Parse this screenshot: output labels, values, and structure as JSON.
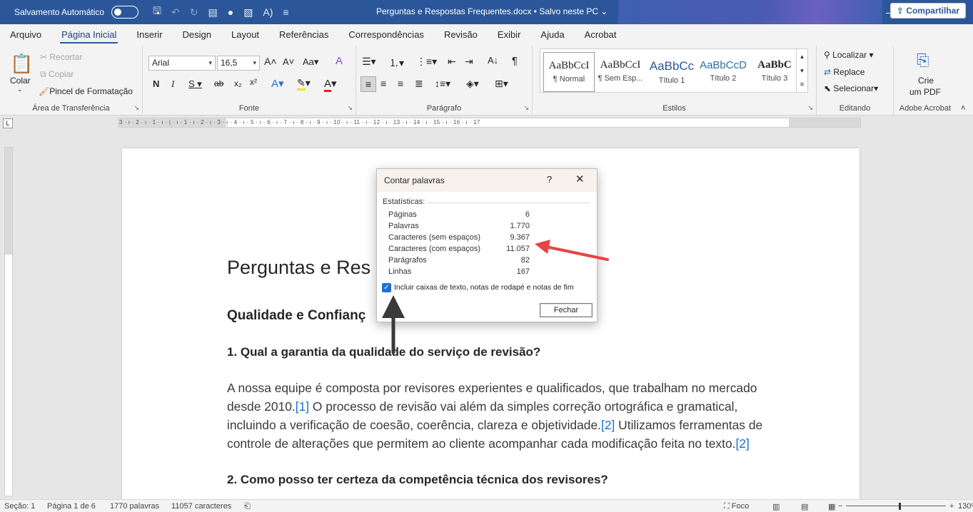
{
  "titlebar": {
    "autosave_label": "Salvamento Automático",
    "doc_title": "Perguntas e Respostas Frequentes.docx • Salvo neste PC ⌄"
  },
  "menu": {
    "tabs": [
      "Arquivo",
      "Página Inicial",
      "Inserir",
      "Design",
      "Layout",
      "Referências",
      "Correspondências",
      "Revisão",
      "Exibir",
      "Ajuda",
      "Acrobat"
    ],
    "active": "Página Inicial",
    "share_label": "Compartilhar"
  },
  "ribbon": {
    "clipboard": {
      "paste": "Colar",
      "cut": "Recortar",
      "copy": "Copiar",
      "format_painter": "Pincel de Formatação",
      "label": "Área de Transferência"
    },
    "font": {
      "name": "Arial",
      "size": "16,5",
      "label": "Fonte",
      "bold": "N",
      "italic": "I",
      "underline": "S",
      "case": "Aa"
    },
    "paragraph": {
      "label": "Parágrafo"
    },
    "styles": {
      "label": "Estilos",
      "items": [
        {
          "preview": "AaBbCcI",
          "name": "¶ Normal"
        },
        {
          "preview": "AaBbCcI",
          "name": "¶ Sem Esp..."
        },
        {
          "preview": "AaBbCc",
          "name": "Título 1"
        },
        {
          "preview": "AaBbCcD",
          "name": "Título 2"
        },
        {
          "preview": "AaBbC",
          "name": "Título 3"
        }
      ]
    },
    "editing": {
      "label": "Editando",
      "find": "Localizar",
      "replace": "Replace",
      "select": "Selecionar"
    },
    "acrobat": {
      "label": "Adobe Acrobat",
      "create_line1": "Crie",
      "create_line2": "um PDF"
    }
  },
  "ruler_text": "3 · ı · 2 · ı · 1 · ı · | · ı · 1 · ı · 2 · ı · 3 · ı · 4 · ı · 5 · ı · 6 · ı · 7 · ı · 8 · ı · 9 · ı · 10 · ı · 11 · ı · 12 · ı · 13 · ı · 14 · ı · 15 · ı · 16 · ı · 17",
  "document": {
    "h1": "Perguntas e Res",
    "h2": "Qualidade e Confianç",
    "q1": "1. Qual a garantia da qualidade do serviço de revisão?",
    "para": [
      "A nossa equipe é composta por revisores experientes e qualificados, que trabalham no mercado",
      "desde 2010.",
      "O processo de revisão vai além da simples correção ortográfica e gramatical,",
      "incluindo a verificação de coesão, coerência, clareza e objetividade.",
      "Utilizamos ferramentas de",
      "controle de alterações que permitem ao cliente acompanhar cada modificação feita no texto."
    ],
    "cites": [
      "[1]",
      "[2]",
      "[2]"
    ],
    "q2": "2. Como posso ter certeza da competência técnica dos revisores?"
  },
  "dialog": {
    "title": "Contar palavras",
    "help": "?",
    "close_x": "✕",
    "section": "Estatísticas:",
    "stats": [
      {
        "label": "Páginas",
        "value": "6"
      },
      {
        "label": "Palavras",
        "value": "1.770"
      },
      {
        "label": "Caracteres (sem espaços)",
        "value": "9.367"
      },
      {
        "label": "Caracteres (com espaços)",
        "value": "11.057"
      },
      {
        "label": "Parágrafos",
        "value": "82"
      },
      {
        "label": "Linhas",
        "value": "167"
      }
    ],
    "checkbox_label": "Incluir caixas de texto, notas de rodapé e notas de fim",
    "checkbox_checked": true,
    "close_button": "Fechar"
  },
  "statusbar": {
    "section": "Seção: 1",
    "page": "Página 1 de 6",
    "words": "1770 palavras",
    "chars": "11057 caracteres",
    "focus": "Foco",
    "zoom": "130%"
  },
  "colors": {
    "titlebar": "#2b579a",
    "arrow_red": "#e84343",
    "arrow_black": "#3a3a3a",
    "checkbox": "#1f6ed4"
  }
}
